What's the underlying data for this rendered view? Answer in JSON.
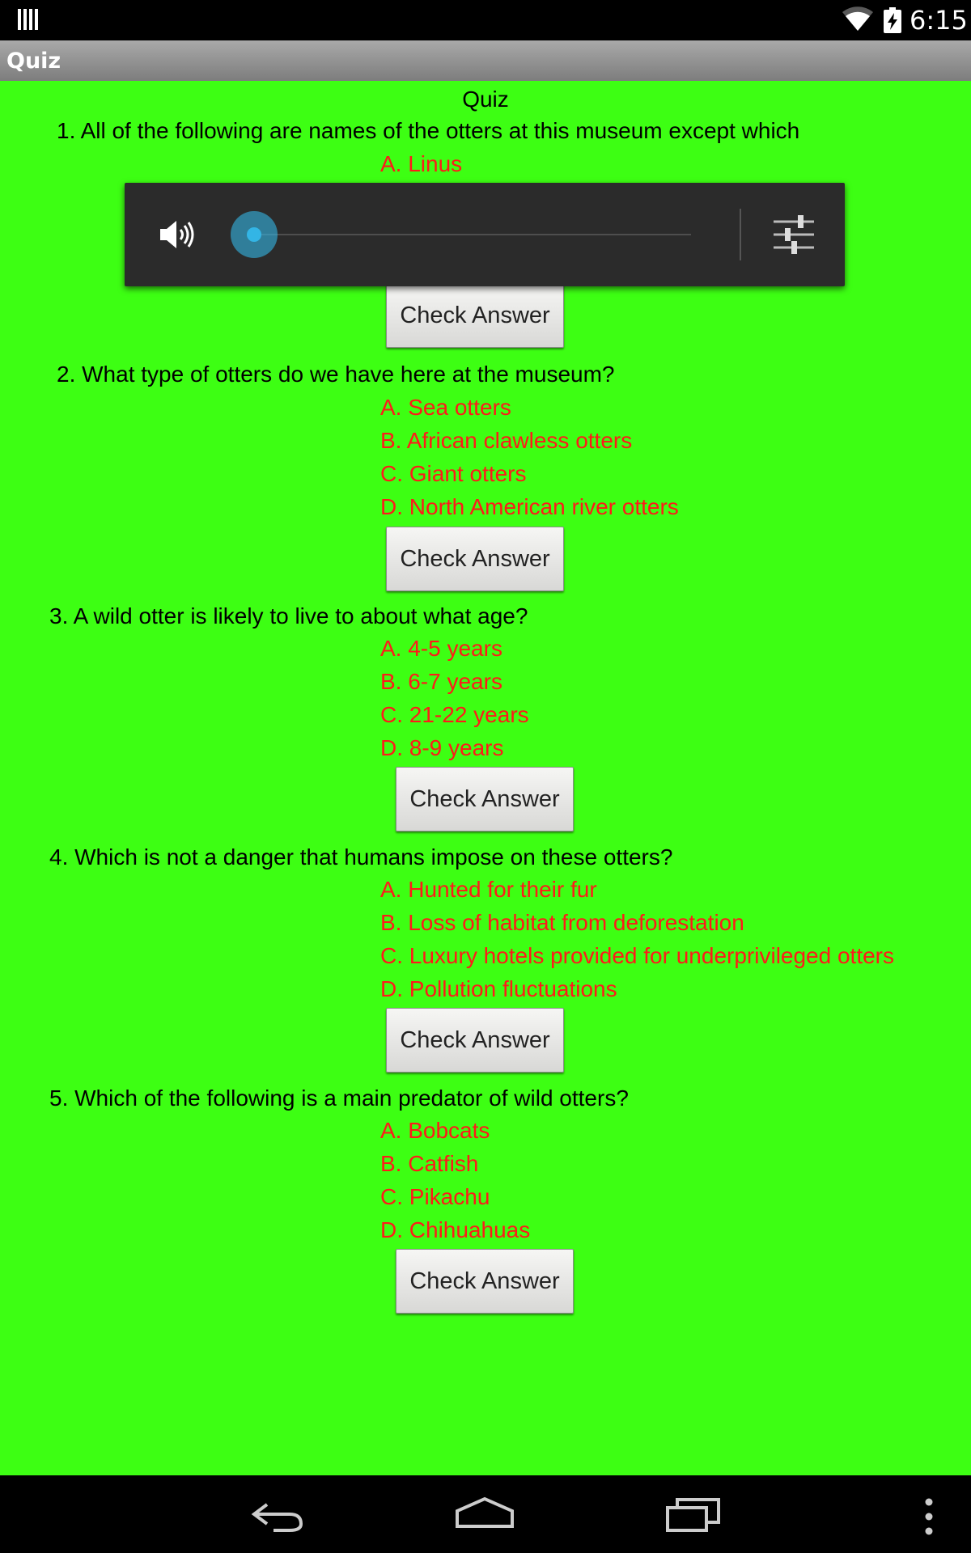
{
  "status_bar": {
    "time": "6:15",
    "icons": [
      "notification-icon",
      "wifi-icon",
      "battery-charging-icon"
    ]
  },
  "app_bar": {
    "title": "Quiz"
  },
  "quiz": {
    "heading": "Quiz",
    "check_label": "Check Answer",
    "questions": [
      {
        "text": "1. All of the following are names of the otters at this museum except which",
        "options": [
          "A. Linus"
        ]
      },
      {
        "text": "2. What type of otters do we have here at the museum?",
        "options": [
          "A. Sea otters",
          "B. African clawless otters",
          "C. Giant otters",
          "D. North American river otters"
        ]
      },
      {
        "text": "3. A wild otter is likely to live to about what age?",
        "options": [
          "A. 4-5 years",
          "B. 6-7 years",
          "C. 21-22 years",
          "D. 8-9 years"
        ]
      },
      {
        "text": "4. Which is not a danger that humans impose on these otters?",
        "options": [
          "A. Hunted for their fur",
          "B. Loss of habitat from deforestation",
          "C. Luxury hotels provided for underprivileged otters",
          "D. Pollution fluctuations"
        ]
      },
      {
        "text": "5. Which of the following is a main predator of wild otters?",
        "options": [
          "A. Bobcats",
          "B. Catfish",
          "C. Pikachu",
          "D. Chihuahuas"
        ]
      }
    ]
  },
  "volume_overlay": {
    "level": 0,
    "accent_color": "#33b5e5",
    "icons": [
      "speaker-icon",
      "sliders-icon"
    ]
  },
  "nav_bar": {
    "icons": [
      "back-icon",
      "home-icon",
      "recents-icon",
      "overflow-menu-icon"
    ]
  },
  "colors": {
    "background": "#3dff13",
    "option_text": "#ff1a1a",
    "question_text": "#000000"
  }
}
